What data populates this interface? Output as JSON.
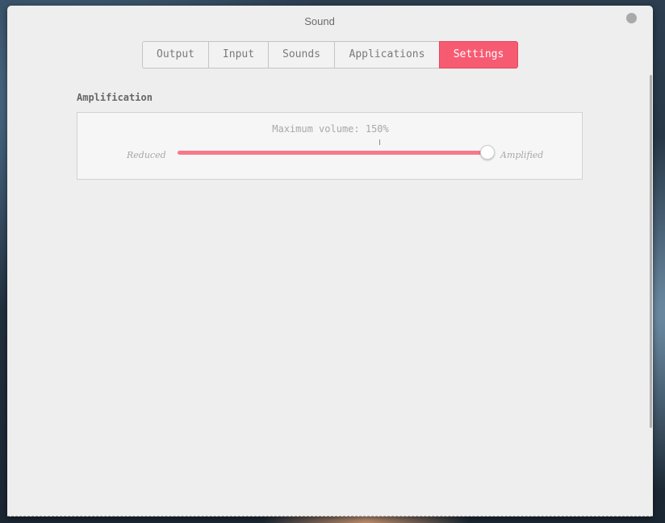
{
  "window": {
    "title": "Sound"
  },
  "tabs": [
    {
      "label": "Output",
      "active": false
    },
    {
      "label": "Input",
      "active": false
    },
    {
      "label": "Sounds",
      "active": false
    },
    {
      "label": "Applications",
      "active": false
    },
    {
      "label": "Settings",
      "active": true
    }
  ],
  "amplification": {
    "section_title": "Amplification",
    "caption": "Maximum volume: 150%",
    "min_label": "Reduced",
    "max_label": "Amplified",
    "slider_value_fraction": 1.0,
    "mark_fraction": 0.65
  },
  "colors": {
    "accent": "#f75b72",
    "slider_fill": "#f7788a",
    "window_bg": "#eeeeee"
  }
}
